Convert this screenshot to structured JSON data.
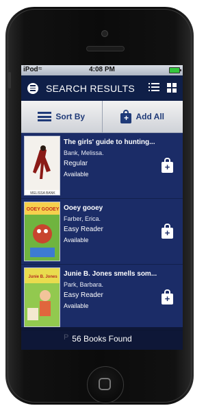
{
  "status": {
    "carrier": "iPod",
    "time": "4:08 PM"
  },
  "header": {
    "title": "SEARCH RESULTS"
  },
  "toolbar": {
    "sort_label": "Sort By",
    "add_all_label": "Add All",
    "add_icon_glyph": "+"
  },
  "books": [
    {
      "title": "The girls' guide to hunting...",
      "author": "Bank, Melissa.",
      "type": "Regular",
      "status": "Available",
      "cover_text": "MELISSA BANK"
    },
    {
      "title": "Ooey gooey",
      "author": "Farber, Erica.",
      "type": "Easy Reader",
      "status": "Available",
      "cover_text": "OOEY GOOEY"
    },
    {
      "title": "Junie B. Jones smells som...",
      "author": "Park, Barbara.",
      "type": "Easy Reader",
      "status": "Available",
      "cover_text": "Junie B. Jones"
    }
  ],
  "footer": {
    "hidden_text": "P",
    "found_text": "56 Books Found"
  },
  "icons": [
    "wifi-icon",
    "battery-icon",
    "menu-icon",
    "list-view-icon",
    "grid-view-icon",
    "sort-icon",
    "add-to-bag-icon"
  ],
  "colors": {
    "header": "#0f1f48",
    "list_bg": "#1b2c67",
    "accent": "#1f3a78"
  }
}
